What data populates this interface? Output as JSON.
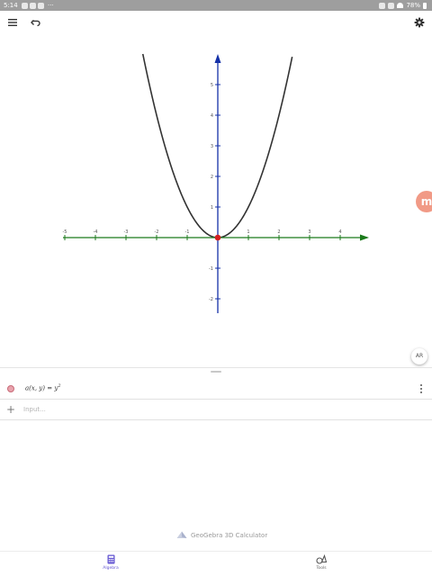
{
  "status_bar": {
    "time": "5:14",
    "more": "···",
    "battery": "78%"
  },
  "toolbar": {
    "menu_icon": "menu-icon",
    "undo_icon": "undo-icon",
    "settings_icon": "gear-icon"
  },
  "graph": {
    "x_ticks": [
      "-5",
      "-4",
      "-3",
      "-2",
      "-1",
      "1",
      "2",
      "3",
      "4"
    ],
    "y_ticks": [
      "5",
      "4",
      "3",
      "2",
      "1",
      "-1",
      "-2"
    ],
    "x_axis_color": "#1b7a1b",
    "y_axis_color": "#1531a8",
    "curve_color": "#333333",
    "point_color": "#d32020",
    "curve_equation": "y = x^2"
  },
  "ar_button": "AR",
  "mascot_letter": "m",
  "algebra": {
    "object1": {
      "name": "a(x, y)",
      "equals": "=",
      "rhs_base": "y",
      "rhs_exp": "2",
      "color": "#e8a3ad"
    },
    "input_placeholder": "Input..."
  },
  "brand": {
    "label": "GeoGebra 3D Calculator"
  },
  "bottom_nav": {
    "algebra_label": "Algebra",
    "tools_label": "Tools",
    "active_color": "#6557d2"
  }
}
